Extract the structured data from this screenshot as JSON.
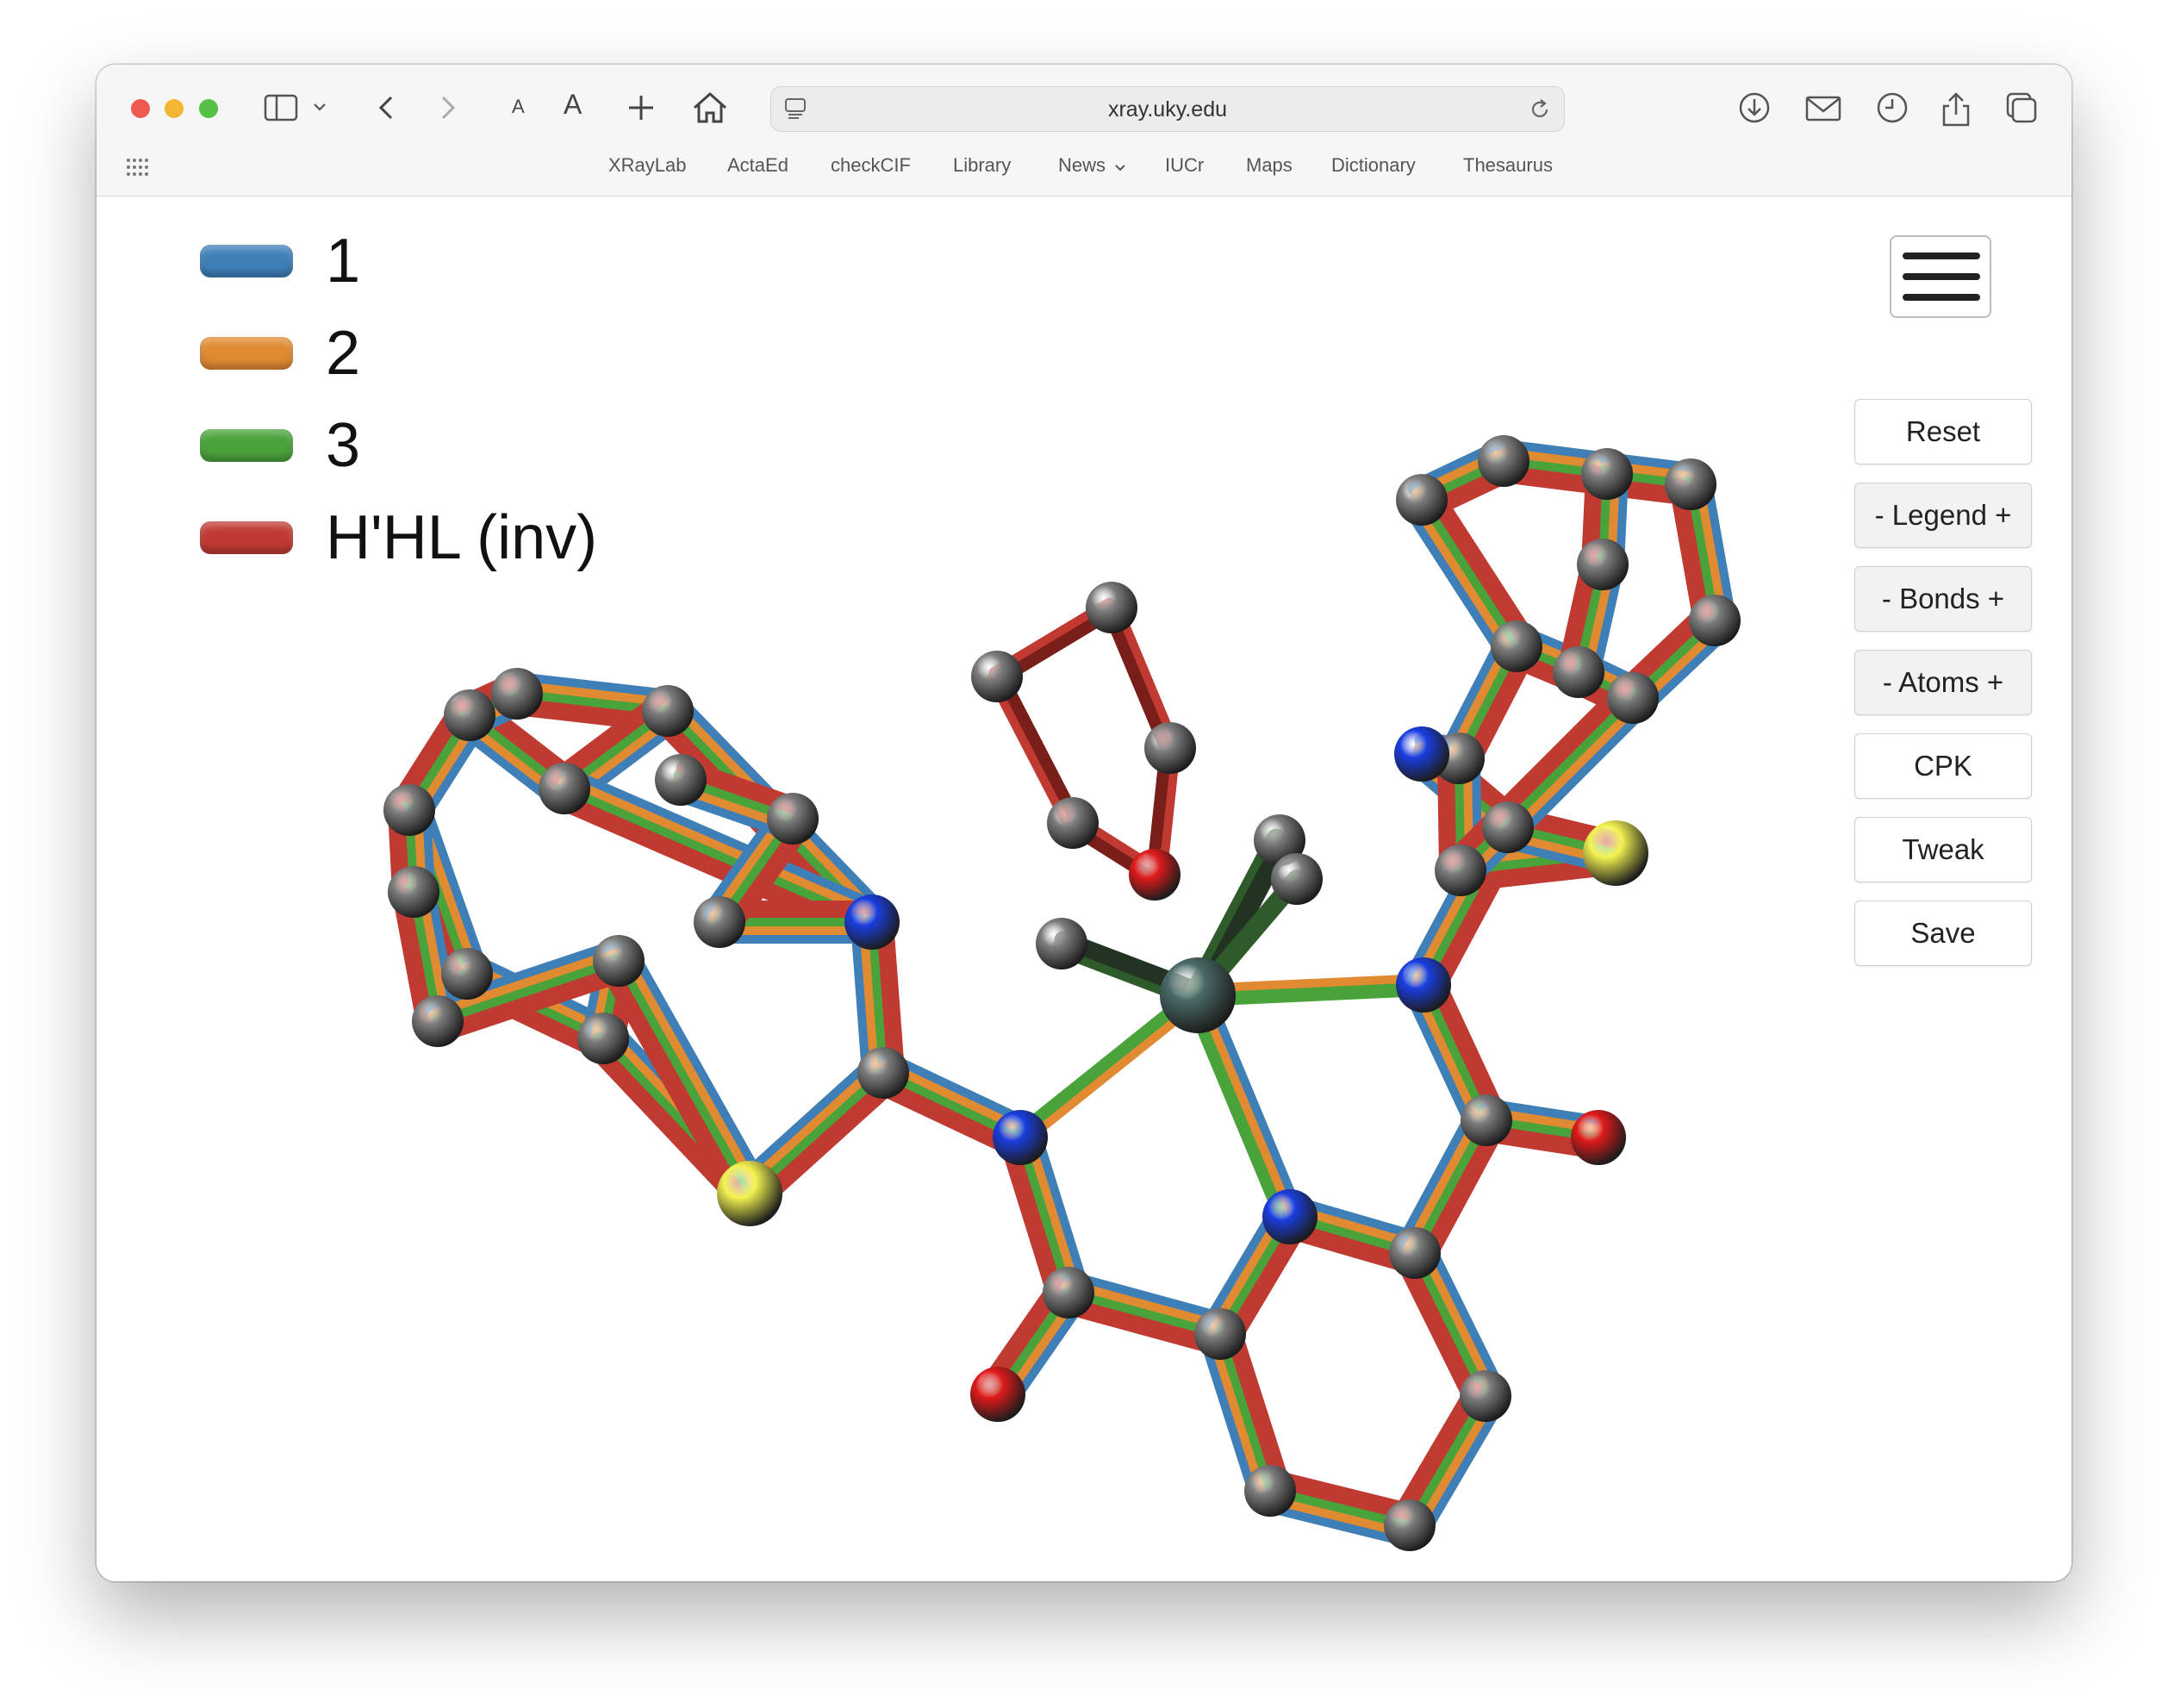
{
  "browser": {
    "url": "xray.uky.edu",
    "font_small_label": "A",
    "font_large_label": "A",
    "bookmarks": [
      "XRayLab",
      "ActaEd",
      "checkCIF",
      "Library",
      "News",
      "IUCr",
      "Maps",
      "Dictionary",
      "Thesaurus"
    ]
  },
  "legend": {
    "items": [
      {
        "label": "1",
        "color": "#3f7fb8"
      },
      {
        "label": "2",
        "color": "#e08a32"
      },
      {
        "label": "3",
        "color": "#4aa23a"
      },
      {
        "label": "H'HL (inv)",
        "color": "#c03a32"
      }
    ]
  },
  "controls": {
    "reset": "Reset",
    "legend": "- Legend +",
    "bonds": "- Bonds +",
    "atoms": "- Atoms +",
    "cpk": "CPK",
    "tweak": "Tweak",
    "save": "Save"
  },
  "atom_colors": {
    "C": "#7d7d7d",
    "N": "#1a3ee0",
    "O": "#e01a1a",
    "S": "#f2f250",
    "M": "#4a6a68"
  }
}
